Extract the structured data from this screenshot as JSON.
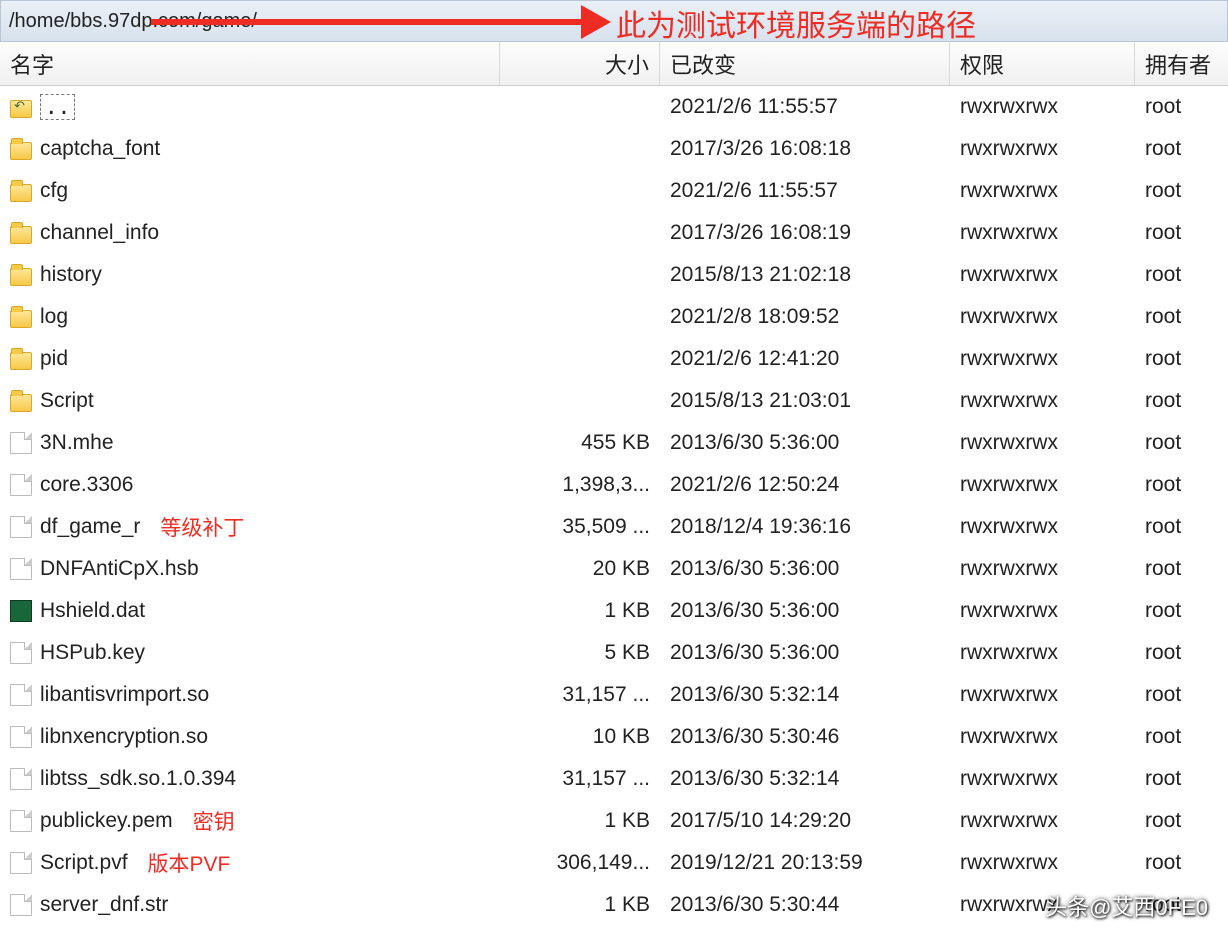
{
  "path": "/home/bbs.97dp.com/game/",
  "annotation": "此为测试环境服务端的路径",
  "columns": {
    "name": "名字",
    "size": "大小",
    "modified": "已改变",
    "perm": "权限",
    "owner": "拥有者"
  },
  "rows": [
    {
      "type": "parent",
      "name": "..",
      "size": "",
      "modified": "2021/2/6 11:55:57",
      "perm": "rwxrwxrwx",
      "owner": "root"
    },
    {
      "type": "folder",
      "name": "captcha_font",
      "size": "",
      "modified": "2017/3/26 16:08:18",
      "perm": "rwxrwxrwx",
      "owner": "root"
    },
    {
      "type": "folder",
      "name": "cfg",
      "size": "",
      "modified": "2021/2/6 11:55:57",
      "perm": "rwxrwxrwx",
      "owner": "root"
    },
    {
      "type": "folder",
      "name": "channel_info",
      "size": "",
      "modified": "2017/3/26 16:08:19",
      "perm": "rwxrwxrwx",
      "owner": "root"
    },
    {
      "type": "folder",
      "name": "history",
      "size": "",
      "modified": "2015/8/13 21:02:18",
      "perm": "rwxrwxrwx",
      "owner": "root"
    },
    {
      "type": "folder",
      "name": "log",
      "size": "",
      "modified": "2021/2/8 18:09:52",
      "perm": "rwxrwxrwx",
      "owner": "root"
    },
    {
      "type": "folder",
      "name": "pid",
      "size": "",
      "modified": "2021/2/6 12:41:20",
      "perm": "rwxrwxrwx",
      "owner": "root"
    },
    {
      "type": "folder",
      "name": "Script",
      "size": "",
      "modified": "2015/8/13 21:03:01",
      "perm": "rwxrwxrwx",
      "owner": "root"
    },
    {
      "type": "file",
      "name": "3N.mhe",
      "size": "455 KB",
      "modified": "2013/6/30 5:36:00",
      "perm": "rwxrwxrwx",
      "owner": "root"
    },
    {
      "type": "file",
      "name": "core.3306",
      "size": "1,398,3...",
      "modified": "2021/2/6 12:50:24",
      "perm": "rwxrwxrwx",
      "owner": "root"
    },
    {
      "type": "file",
      "name": "df_game_r",
      "note": "等级补丁",
      "size": "35,509 ...",
      "modified": "2018/12/4 19:36:16",
      "perm": "rwxrwxrwx",
      "owner": "root"
    },
    {
      "type": "file",
      "name": "DNFAntiCpX.hsb",
      "size": "20 KB",
      "modified": "2013/6/30 5:36:00",
      "perm": "rwxrwxrwx",
      "owner": "root"
    },
    {
      "type": "dat",
      "name": "Hshield.dat",
      "size": "1 KB",
      "modified": "2013/6/30 5:36:00",
      "perm": "rwxrwxrwx",
      "owner": "root"
    },
    {
      "type": "file",
      "name": "HSPub.key",
      "size": "5 KB",
      "modified": "2013/6/30 5:36:00",
      "perm": "rwxrwxrwx",
      "owner": "root"
    },
    {
      "type": "file",
      "name": "libantisvrimport.so",
      "size": "31,157 ...",
      "modified": "2013/6/30 5:32:14",
      "perm": "rwxrwxrwx",
      "owner": "root"
    },
    {
      "type": "file",
      "name": "libnxencryption.so",
      "size": "10 KB",
      "modified": "2013/6/30 5:30:46",
      "perm": "rwxrwxrwx",
      "owner": "root"
    },
    {
      "type": "file",
      "name": "libtss_sdk.so.1.0.394",
      "size": "31,157 ...",
      "modified": "2013/6/30 5:32:14",
      "perm": "rwxrwxrwx",
      "owner": "root"
    },
    {
      "type": "file",
      "name": "publickey.pem",
      "note": "密钥",
      "size": "1 KB",
      "modified": "2017/5/10 14:29:20",
      "perm": "rwxrwxrwx",
      "owner": "root"
    },
    {
      "type": "file",
      "name": "Script.pvf",
      "note": "版本PVF",
      "size": "306,149...",
      "modified": "2019/12/21 20:13:59",
      "perm": "rwxrwxrwx",
      "owner": "root"
    },
    {
      "type": "file",
      "name": "server_dnf.str",
      "size": "1 KB",
      "modified": "2013/6/30 5:30:44",
      "perm": "rwxrwxrwx",
      "owner": "root"
    }
  ],
  "watermark": "头条@艾西0FE0"
}
